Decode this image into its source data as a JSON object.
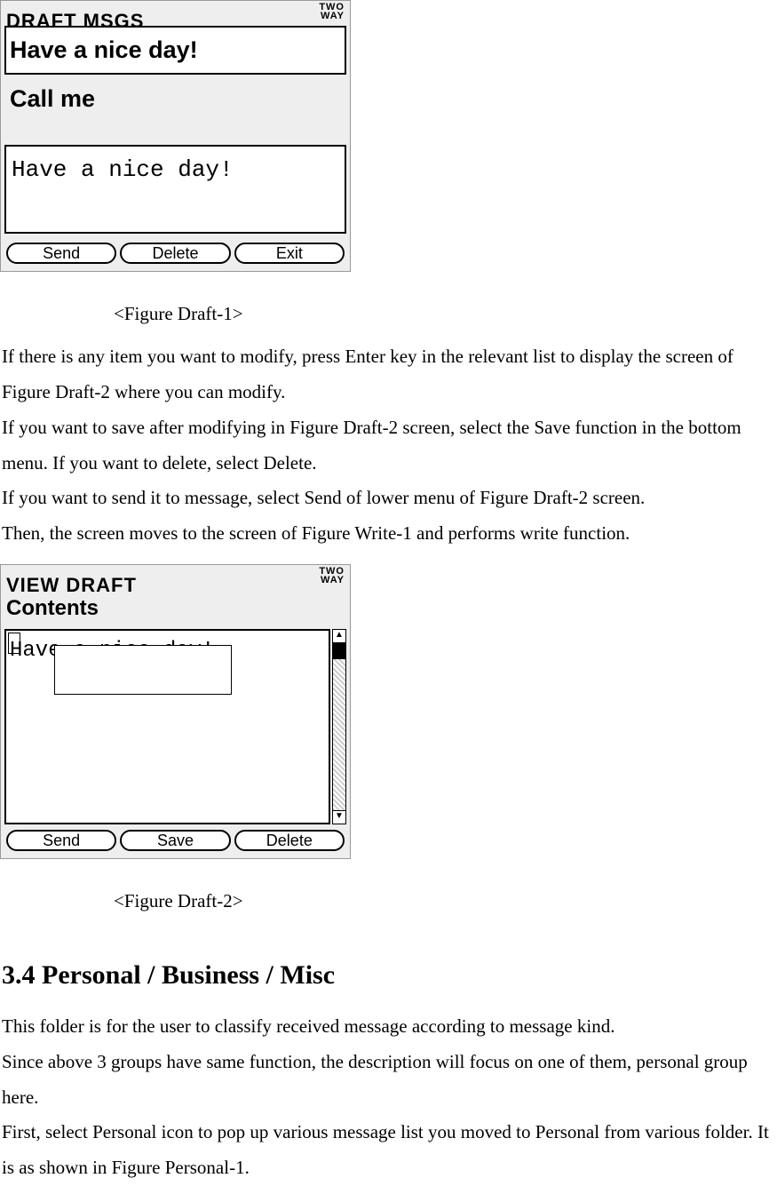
{
  "figure1": {
    "title": "DRAFT MSGS",
    "twoway_line1": "TWO",
    "twoway_line2": "WAY",
    "items": [
      "Have a nice day!",
      "Call me"
    ],
    "preview": "Have a nice day!",
    "buttons": [
      "Send",
      "Delete",
      "Exit"
    ]
  },
  "caption1": "<Figure Draft-1>",
  "paras1": [
    "If there is any item you want to modify, press Enter key in the relevant list to display the screen of Figure Draft-2 where you can modify.",
    "If you want to save after modifying in Figure Draft-2 screen, select the Save function in the bottom menu. If you want to delete, select Delete.",
    "If you want to send it to message, select Send of lower menu of Figure Draft-2 screen.",
    "Then, the screen moves to the screen of Figure Write-1 and performs write function."
  ],
  "figure2": {
    "title": "VIEW DRAFT",
    "twoway_line1": "TWO",
    "twoway_line2": "WAY",
    "contents_label": "Contents",
    "edit_text": "Have a nice day!",
    "buttons": [
      "Send",
      "Save",
      "Delete"
    ]
  },
  "caption2": "<Figure Draft-2>",
  "section_heading": "3.4 Personal / Business / Misc",
  "paras2": [
    "This folder is for the user to classify received message according to message kind.",
    "Since above 3 groups have same function, the description will focus on one of them, personal group here.",
    "First, select Personal icon to pop up various message list you moved to Personal from various folder. It is as shown in Figure Personal-1."
  ]
}
